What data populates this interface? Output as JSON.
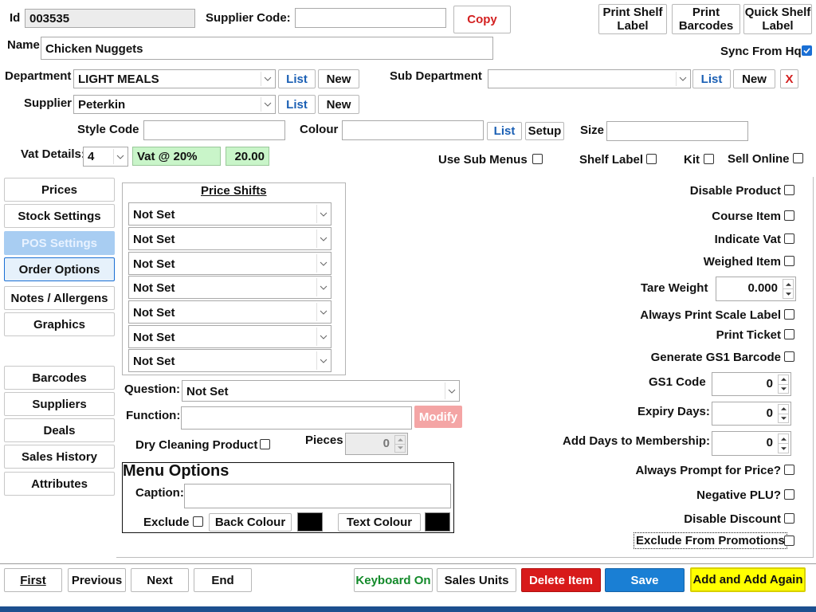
{
  "header": {
    "id_label": "Id",
    "id_value": "003535",
    "supplier_code_label": "Supplier Code:",
    "supplier_code_value": "",
    "copy_label": "Copy",
    "print_shelf_label": "Print Shelf Label",
    "print_barcodes": "Print Barcodes",
    "quick_shelf_label": "Quick Shelf Label",
    "name_label": "Name",
    "name_value": "Chicken Nuggets",
    "sync_label": "Sync From Hq",
    "sync_checked": true
  },
  "dept": {
    "department_label": "Department",
    "department_value": "LIGHT MEALS",
    "list_label": "List",
    "new_label": "New",
    "sub_department_label": "Sub Department",
    "sub_department_value": "",
    "remove_label": "X",
    "supplier_label": "Supplier",
    "supplier_value": "Peterkin"
  },
  "style": {
    "style_code_label": "Style Code",
    "style_code_value": "",
    "colour_label": "Colour",
    "colour_value": "",
    "list_label": "List",
    "setup_label": "Setup",
    "size_label": "Size",
    "size_value": ""
  },
  "vat": {
    "label": "Vat Details:",
    "code": "4",
    "description": "Vat @ 20%",
    "rate": "20.00",
    "use_sub_menus": "Use Sub Menus",
    "shelf_label": "Shelf Label",
    "kit": "Kit",
    "sell_online": "Sell Online"
  },
  "tabs": [
    {
      "label": "Prices"
    },
    {
      "label": "Stock Settings"
    },
    {
      "label": "POS Settings"
    },
    {
      "label": "Order Options"
    },
    {
      "label": "Notes / Allergens"
    },
    {
      "label": "Graphics"
    },
    {
      "label": "Barcodes"
    },
    {
      "label": "Suppliers"
    },
    {
      "label": "Deals"
    },
    {
      "label": "Sales History"
    },
    {
      "label": "Attributes"
    }
  ],
  "price_shifts": {
    "title": "Price Shifts",
    "items": [
      "Not Set",
      "Not Set",
      "Not Set",
      "Not Set",
      "Not Set",
      "Not Set",
      "Not Set"
    ]
  },
  "pos": {
    "question_label": "Question:",
    "question_value": "Not Set",
    "function_label": "Function:",
    "function_value": "",
    "modify_label": "Modify",
    "dry_cleaning_label": "Dry Cleaning Product",
    "pieces_label": "Pieces",
    "pieces_value": "0"
  },
  "menu_options": {
    "title": "Menu Options",
    "caption_label": "Caption:",
    "caption_value": "",
    "exclude_label": "Exclude",
    "back_colour_label": "Back Colour",
    "text_colour_label": "Text Colour"
  },
  "right": {
    "disable_product": "Disable Product",
    "course_item": "Course Item",
    "indicate_vat": "Indicate Vat",
    "weighed_item": "Weighed Item",
    "tare_weight_label": "Tare Weight",
    "tare_weight_value": "0.000",
    "always_print_scale": "Always Print Scale Label",
    "print_ticket": "Print Ticket",
    "generate_gs1": "Generate GS1 Barcode",
    "gs1_code_label": "GS1 Code",
    "gs1_code_value": "0",
    "expiry_days_label": "Expiry Days:",
    "expiry_days_value": "0",
    "add_days_label": "Add Days to Membership:",
    "add_days_value": "0",
    "always_prompt_price": "Always Prompt for Price?",
    "negative_plu": "Negative PLU?",
    "disable_discount": "Disable Discount",
    "exclude_promotions": "Exclude From Promotions"
  },
  "footer": {
    "first": "First",
    "previous": "Previous",
    "next": "Next",
    "end": "End",
    "keyboard_on": "Keyboard On",
    "sales_units": "Sales Units",
    "delete_item": "Delete Item",
    "save": "Save",
    "add_again": "Add and Add Again"
  },
  "colors": {
    "accent": "#1a6fd4",
    "save_bg": "#1a7fd4",
    "delete_bg": "#d81a1a",
    "add_again_bg": "#ffff00",
    "vat_green": "#c9f5c9",
    "taskbar": "#1c4f8f"
  }
}
